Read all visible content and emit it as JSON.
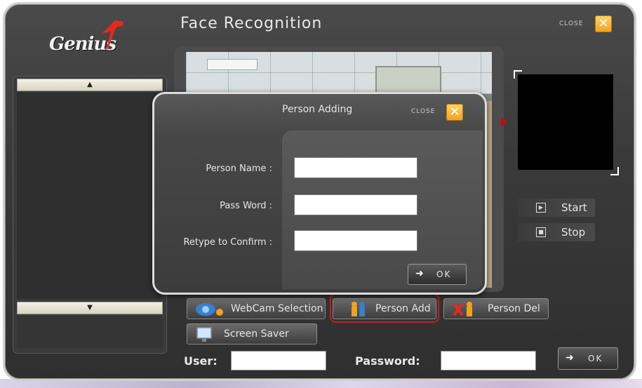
{
  "app": {
    "logo_text": "Genius",
    "title": "Face Recognition",
    "close_label": "CLOSE",
    "close_symbol": "✕"
  },
  "controls": {
    "start_label": "Start",
    "stop_label": "Stop"
  },
  "toolbar": {
    "webcam_label": "WebCam Selection",
    "person_add_label": "Person Add",
    "person_del_label": "Person Del",
    "screen_saver_label": "Screen Saver"
  },
  "login": {
    "user_label": "User:",
    "password_label": "Password:",
    "user_value": "",
    "password_value": "",
    "ok_label": "OK"
  },
  "dialog": {
    "title": "Person Adding",
    "close_label": "CLOSE",
    "close_symbol": "✕",
    "fields": [
      {
        "label": "Person Name :",
        "value": ""
      },
      {
        "label": "Pass Word :",
        "value": ""
      },
      {
        "label": "Retype to Confirm :",
        "value": ""
      }
    ],
    "ok_label": "OK"
  },
  "colors": {
    "highlight": "#c0202a",
    "close_accent": "#f2a21c"
  }
}
